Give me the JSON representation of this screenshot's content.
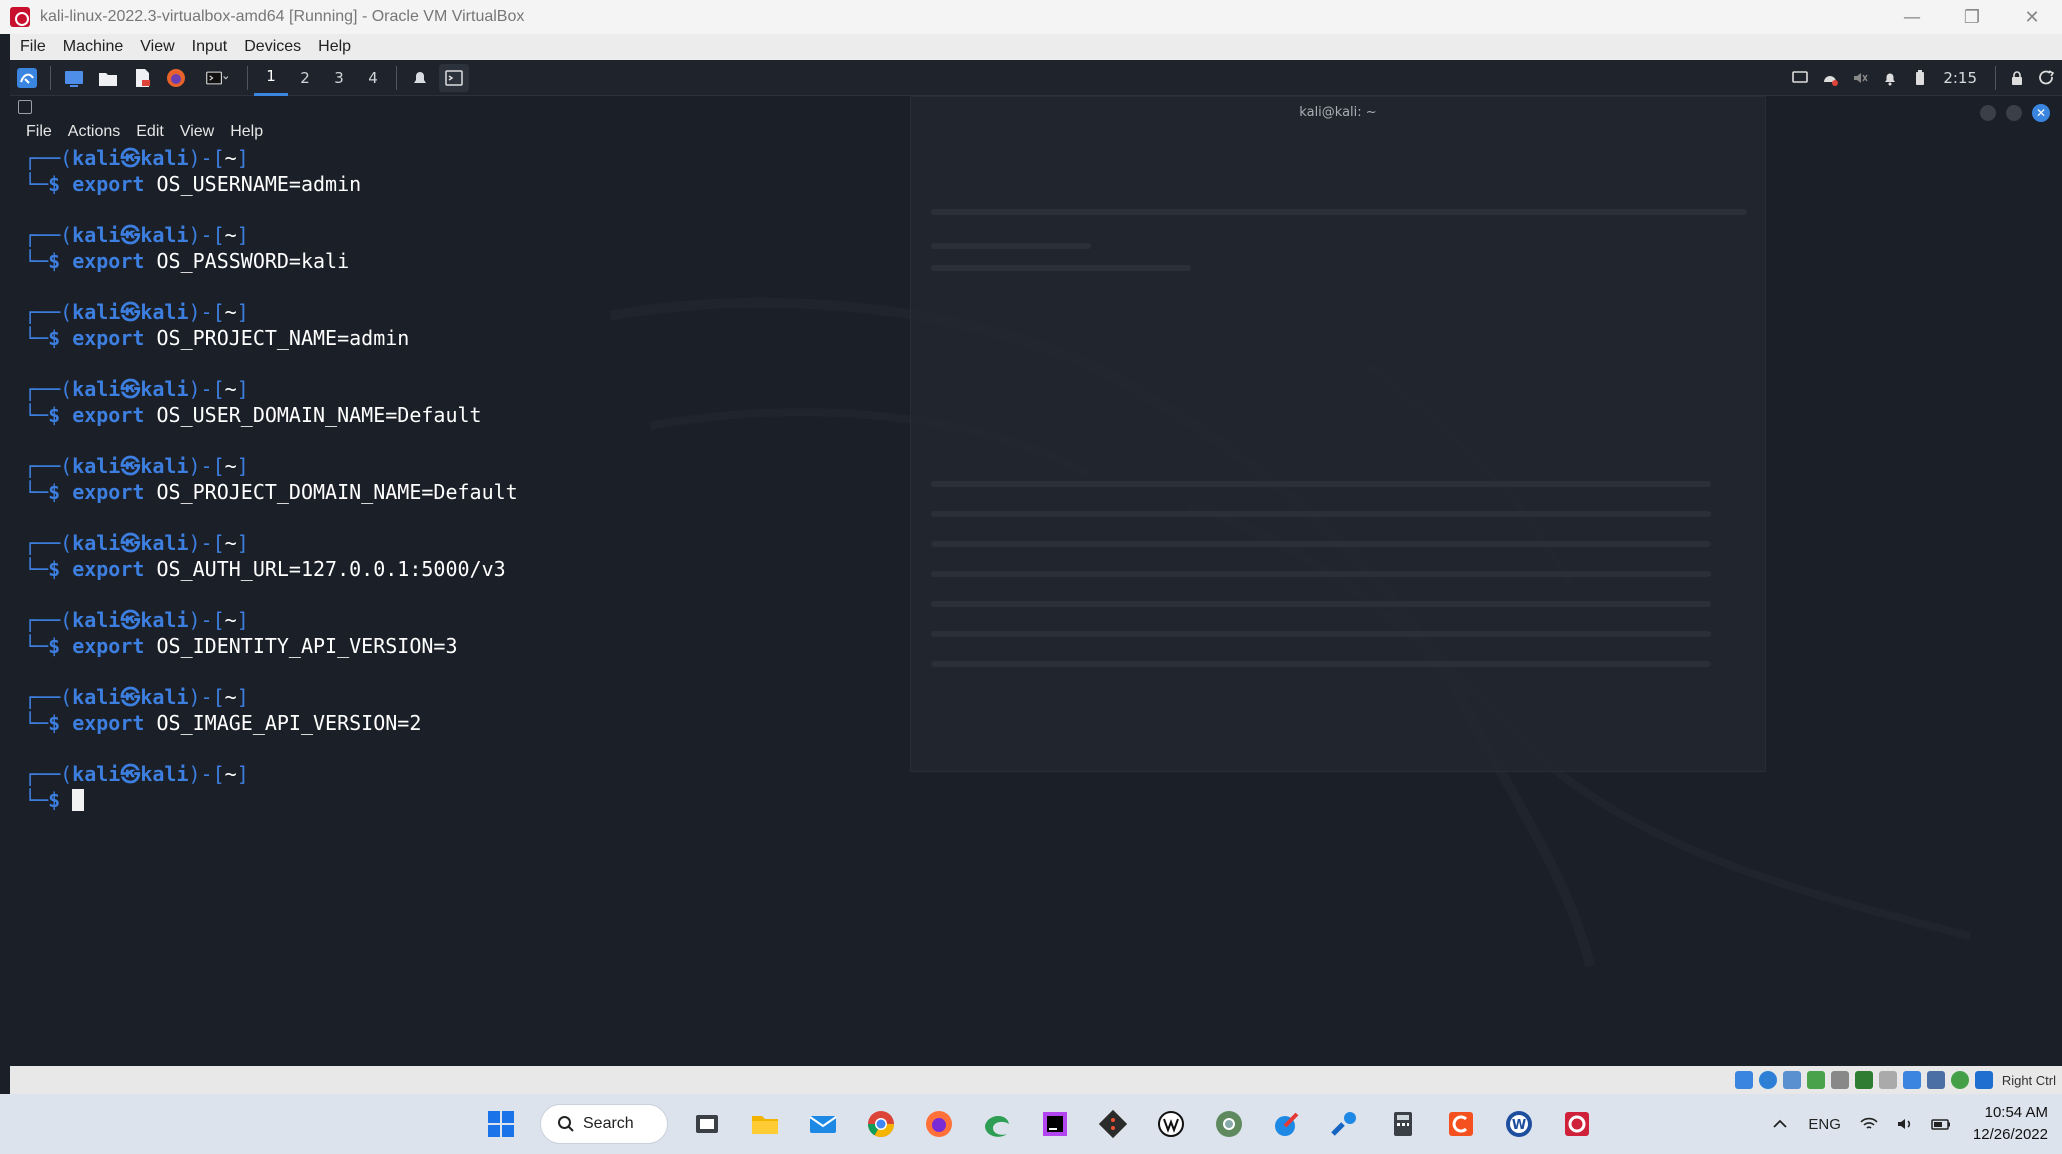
{
  "window": {
    "title": "kali-linux-2022.3-virtualbox-amd64 [Running] - Oracle VM VirtualBox",
    "controls": {
      "minimize": "—",
      "restore": "❐",
      "close": "✕"
    }
  },
  "vbox_menu": [
    "File",
    "Machine",
    "View",
    "Input",
    "Devices",
    "Help"
  ],
  "kali_panel": {
    "workspaces": [
      "1",
      "2",
      "3",
      "4"
    ],
    "clock": "2:15"
  },
  "terminal": {
    "menu": [
      "File",
      "Actions",
      "Edit",
      "View",
      "Help"
    ],
    "prompt": {
      "line1_prefix": "┌──(",
      "user": "kali",
      "at": "㉿",
      "host": "kali",
      "line1_mid": ")-[",
      "dir": "~",
      "line1_suffix": "]",
      "line2_prefix": "└─",
      "dollar": "$"
    },
    "commands": [
      {
        "keyword": "export",
        "arg": "OS_USERNAME=admin"
      },
      {
        "keyword": "export",
        "arg": "OS_PASSWORD=kali"
      },
      {
        "keyword": "export",
        "arg": "OS_PROJECT_NAME=admin"
      },
      {
        "keyword": "export",
        "arg": "OS_USER_DOMAIN_NAME=Default"
      },
      {
        "keyword": "export",
        "arg": "OS_PROJECT_DOMAIN_NAME=Default"
      },
      {
        "keyword": "export",
        "arg": "OS_AUTH_URL=127.0.0.1:5000/v3"
      },
      {
        "keyword": "export",
        "arg": "OS_IDENTITY_API_VERSION=3"
      },
      {
        "keyword": "export",
        "arg": "OS_IMAGE_API_VERSION=2"
      }
    ]
  },
  "background_window": {
    "title": "kali@kali: ~"
  },
  "vbox_status": {
    "host_key": "Right Ctrl"
  },
  "taskbar": {
    "search_label": "Search",
    "language": "ENG",
    "time": "10:54 AM",
    "date": "12/26/2022"
  },
  "colors": {
    "kali_blue": "#3d7fe0",
    "terminal_bg": "#1b1f27",
    "taskbar_bg": "#dce3ec"
  }
}
